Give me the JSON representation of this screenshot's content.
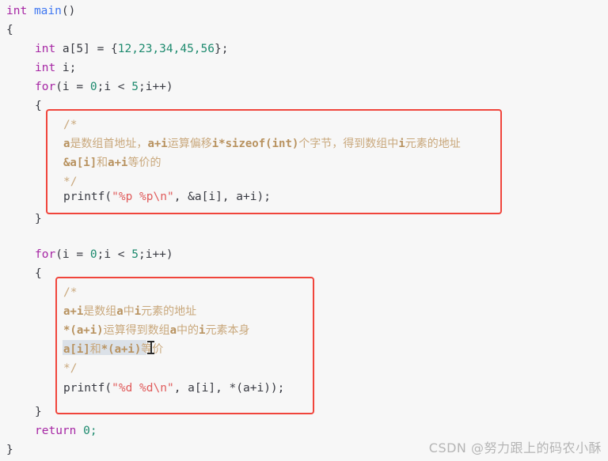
{
  "editor": {
    "background_color": "#f7f7f7",
    "language": "C",
    "code_lines": [
      {
        "indent": 0,
        "text": "int main()"
      },
      {
        "indent": 0,
        "text": "{"
      },
      {
        "indent": 1,
        "text": "int a[5] = {12,23,34,45,56};"
      },
      {
        "indent": 1,
        "text": "int i;"
      },
      {
        "indent": 1,
        "text": "for(i = 0;i < 5;i++)"
      },
      {
        "indent": 1,
        "text": "{"
      },
      {
        "indent": 2,
        "text": "/*"
      },
      {
        "indent": 2,
        "text": "a是数组首地址，a+i运算偏移i*sizeof(int)个字节，得到数组中i元素的地址"
      },
      {
        "indent": 2,
        "text": "&a[i]和a+i等价的"
      },
      {
        "indent": 2,
        "text": "*/"
      },
      {
        "indent": 2,
        "text": "printf(\"%p %p\\n\", &a[i], a+i);"
      },
      {
        "indent": 1,
        "text": "}"
      },
      {
        "indent": 0,
        "text": ""
      },
      {
        "indent": 1,
        "text": "for(i = 0;i < 5;i++)"
      },
      {
        "indent": 1,
        "text": "{"
      },
      {
        "indent": 2,
        "text": "/*"
      },
      {
        "indent": 2,
        "text": "a+i是数组a中i元素的地址"
      },
      {
        "indent": 2,
        "text": "*(a+i)运算得到数组a中的i元素本身"
      },
      {
        "indent": 2,
        "text": "a[i]和*(a+i)等价"
      },
      {
        "indent": 2,
        "text": "*/"
      },
      {
        "indent": 2,
        "text": "printf(\"%d %d\\n\", a[i], *(a+i));"
      },
      {
        "indent": 1,
        "text": "}"
      },
      {
        "indent": 1,
        "text": "return 0;"
      },
      {
        "indent": 0,
        "text": "}"
      }
    ],
    "tokens": {
      "signature": {
        "kw": "int",
        "fn": "main",
        "parens": "()"
      },
      "open_brace": "{",
      "close_brace": "}",
      "decl_array": {
        "kw": "int",
        "name": " a[5] = {",
        "values": "12,23,34,45,56",
        "tail": "};"
      },
      "decl_index": {
        "kw": "int",
        "name": " i;"
      },
      "for_loop": {
        "kw": "for",
        "open": "(i = ",
        "zero": "0",
        "mid": ";i < ",
        "five": "5",
        "tail": ";i++)"
      },
      "printf_1": {
        "fn": "printf",
        "open": "(",
        "str": "\"%p %p\\n\"",
        "args": ", &a[i], a+i);"
      },
      "printf_2": {
        "fn": "printf",
        "open": "(",
        "str": "\"%d %d\\n\"",
        "args": ", a[i], *(a+i));"
      },
      "return_stmt": {
        "kw": "return",
        "value": " 0;"
      },
      "comment_open": "/*",
      "comment_close": "*/"
    },
    "comment_block_1": {
      "line_1": "/*",
      "line_2_code_a": "a",
      "line_2_cjk_a": "是数组首地址，",
      "line_2_code_b": "a+i",
      "line_2_cjk_b": "运算偏移",
      "line_2_code_c": "i*sizeof(int)",
      "line_2_cjk_c": "个字节，得到数组中",
      "line_2_code_d": "i",
      "line_2_cjk_d": "元素的地址",
      "line_3_code_a": "&a[i]",
      "line_3_cjk_a": "和",
      "line_3_code_b": "a+i",
      "line_3_cjk_b": "等价的",
      "line_4": "*/"
    },
    "comment_block_2": {
      "line_1": "/*",
      "line_2_code_a": "a+i",
      "line_2_cjk_a": "是数组",
      "line_2_code_b": "a",
      "line_2_cjk_b": "中",
      "line_2_code_c": "i",
      "line_2_cjk_c": "元素的地址",
      "line_3_code_a": "*(a+i)",
      "line_3_cjk_a": "运算得到数组",
      "line_3_code_b": "a",
      "line_3_cjk_b": "中的",
      "line_3_code_c": "i",
      "line_3_cjk_c": "元素本身",
      "line_4_code_a": "a[i]",
      "line_4_cjk_a": "和",
      "line_4_code_b": "*(a+i)",
      "line_4_cjk_b": "等价",
      "line_5": "*/"
    },
    "annotations": {
      "box_1_label": "red-highlight-rectangle-upper",
      "box_2_label": "red-highlight-rectangle-lower",
      "box_color": "#f0453c"
    },
    "selection": {
      "highlight_color": "#d6dde5",
      "selected_text": "a[i]和*(a+i)等"
    }
  },
  "watermark": {
    "text": "CSDN @努力跟上的码农小酥",
    "color": "#b5b5b5"
  }
}
